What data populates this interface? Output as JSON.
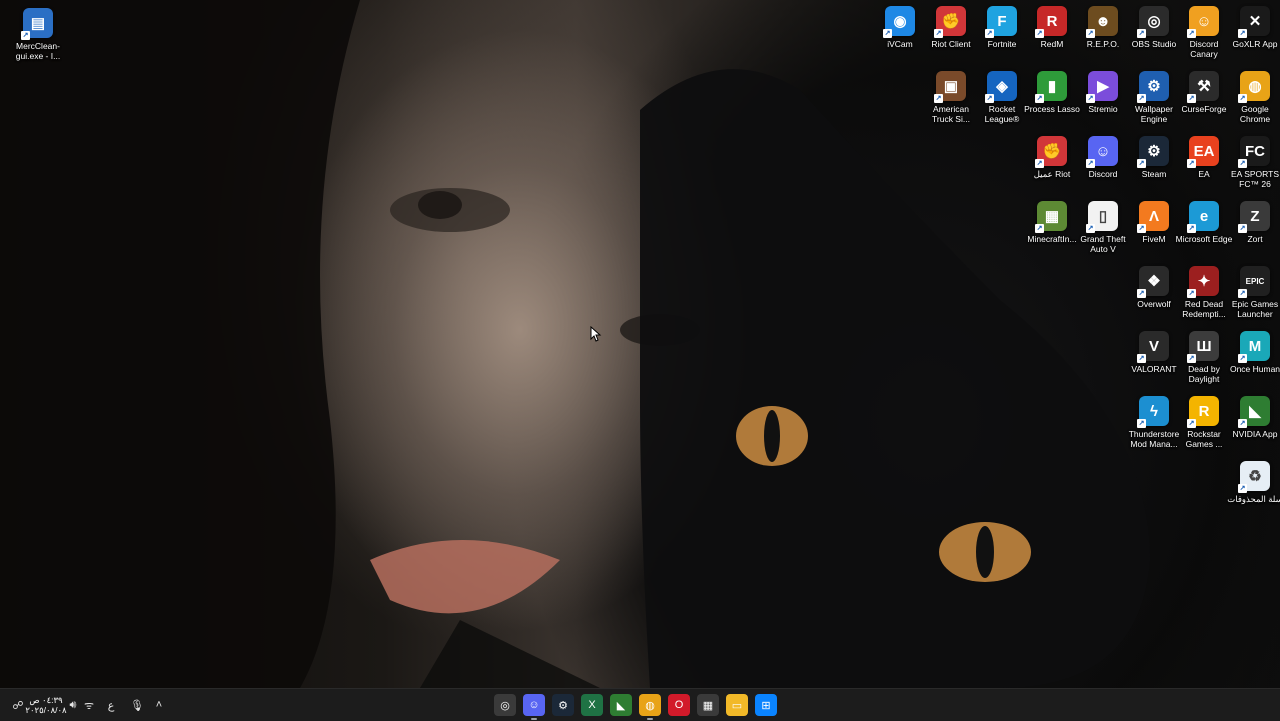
{
  "desktop": {
    "left_icons": [
      {
        "name": "merc-clean-icon",
        "label": "MercClean-gui.exe - I...",
        "color": "#2b6fc4",
        "glyph": "▤"
      }
    ],
    "grid": [
      {
        "name": "ivcam-icon",
        "label": "iVCam",
        "color": "#1e88e5",
        "glyph": "◉"
      },
      {
        "name": "riot-client-icon",
        "label": "Riot Client",
        "color": "#d13639",
        "glyph": "✊"
      },
      {
        "name": "fortnite-icon",
        "label": "Fortnite",
        "color": "#1fa3e0",
        "glyph": "F"
      },
      {
        "name": "redm-icon",
        "label": "RedM",
        "color": "#c62828",
        "glyph": "R"
      },
      {
        "name": "repo-icon",
        "label": "R.E.P.O.",
        "color": "#6d4c1f",
        "glyph": "☻"
      },
      {
        "name": "obs-studio-icon",
        "label": "OBS Studio",
        "color": "#2b2b2b",
        "glyph": "◎"
      },
      {
        "name": "discord-canary-icon",
        "label": "Discord Canary",
        "color": "#f0a020",
        "glyph": "☺"
      },
      {
        "name": "goxlr-app-icon",
        "label": "GoXLR App",
        "color": "#1a1a1a",
        "glyph": "✕"
      },
      {
        "name": "american-truck-icon",
        "label": "American Truck Si...",
        "color": "#7a4a2a",
        "glyph": "▣"
      },
      {
        "name": "rocket-league-icon",
        "label": "Rocket League®",
        "color": "#1565c0",
        "glyph": "◈"
      },
      {
        "name": "process-lasso-icon",
        "label": "Process Lasso",
        "color": "#2e9b3a",
        "glyph": "▮"
      },
      {
        "name": "stremio-icon",
        "label": "Stremio",
        "color": "#7b4ddb",
        "glyph": "▶"
      },
      {
        "name": "wallpaper-engine-icon",
        "label": "Wallpaper Engine",
        "color": "#1f5fb0",
        "glyph": "⚙"
      },
      {
        "name": "curseforge-icon",
        "label": "CurseForge",
        "color": "#2b2b2b",
        "glyph": "⚒"
      },
      {
        "name": "google-chrome-icon",
        "label": "Google Chrome",
        "color": "#e8a317",
        "glyph": "◍"
      },
      {
        "name": "riot-arabic-icon",
        "label": "عميل Riot",
        "color": "#d13639",
        "glyph": "✊"
      },
      {
        "name": "discord-icon",
        "label": "Discord",
        "color": "#5865f2",
        "glyph": "☺"
      },
      {
        "name": "steam-icon",
        "label": "Steam",
        "color": "#1b2838",
        "glyph": "⚙"
      },
      {
        "name": "ea-icon",
        "label": "EA",
        "color": "#e8411e",
        "glyph": "EA"
      },
      {
        "name": "ea-sports-fc-icon",
        "label": "EA SPORTS FC™ 26",
        "color": "#1a1a1a",
        "glyph": "FC"
      },
      {
        "name": "minecraft-icon",
        "label": "MinecraftIn...",
        "color": "#5d8a34",
        "glyph": "▦"
      },
      {
        "name": "gta-v-icon",
        "label": "Grand Theft Auto V",
        "color": "#f2f2f2",
        "glyph": "▯"
      },
      {
        "name": "fivem-icon",
        "label": "FiveM",
        "color": "#f37a1f",
        "glyph": "Λ"
      },
      {
        "name": "microsoft-edge-icon",
        "label": "Microsoft Edge",
        "color": "#1c9ad6",
        "glyph": "e"
      },
      {
        "name": "zort-icon",
        "label": "Zort",
        "color": "#3a3a3a",
        "glyph": "Z"
      },
      {
        "name": "overwolf-icon",
        "label": "Overwolf",
        "color": "#2a2a2a",
        "glyph": "❖"
      },
      {
        "name": "red-dead-icon",
        "label": "Red Dead Redempti...",
        "color": "#9c1f1f",
        "glyph": "✦"
      },
      {
        "name": "epic-games-icon",
        "label": "Epic Games Launcher",
        "color": "#202020",
        "glyph": "EPIC"
      },
      {
        "name": "valorant-icon",
        "label": "VALORANT",
        "color": "#2a2a2a",
        "glyph": "V"
      },
      {
        "name": "dead-by-daylight-icon",
        "label": "Dead by Daylight",
        "color": "#3c3c3c",
        "glyph": "Ш"
      },
      {
        "name": "once-human-icon",
        "label": "Once Human",
        "color": "#1aa8b8",
        "glyph": "M"
      },
      {
        "name": "thunderstore-icon",
        "label": "Thunderstore Mod Mana...",
        "color": "#1c8fd1",
        "glyph": "ϟ"
      },
      {
        "name": "rockstar-games-icon",
        "label": "Rockstar Games ...",
        "color": "#f4b400",
        "glyph": "R"
      },
      {
        "name": "nvidia-app-icon",
        "label": "NVIDIA App",
        "color": "#2e7d32",
        "glyph": "◣"
      },
      {
        "name": "recycle-bin-icon",
        "label": "سلة المحذوفات",
        "color": "#e6eef5",
        "glyph": "♻"
      }
    ]
  },
  "taskbar": {
    "clock_time": "٠٤:٣٩ ص",
    "clock_date": "٢٠٢٥/٠٨/٠٨",
    "language": "ع",
    "tray_icons": [
      "notification-icon",
      "volume-icon",
      "wifi-icon",
      "language-indicator",
      "microphone-icon",
      "chevron-up-icon"
    ],
    "apps": [
      {
        "name": "taskbar-app-1",
        "color": "#3a3a3a",
        "glyph": "◎",
        "active": false
      },
      {
        "name": "taskbar-discord",
        "color": "#5865f2",
        "glyph": "☺",
        "active": true
      },
      {
        "name": "taskbar-steam",
        "color": "#1b2838",
        "glyph": "⚙",
        "active": false
      },
      {
        "name": "taskbar-excel",
        "color": "#1f7244",
        "glyph": "X",
        "active": false
      },
      {
        "name": "taskbar-nvidia",
        "color": "#2e7d32",
        "glyph": "◣",
        "active": false
      },
      {
        "name": "taskbar-chrome",
        "color": "#e8a317",
        "glyph": "◍",
        "active": true
      },
      {
        "name": "taskbar-opera",
        "color": "#d21a2a",
        "glyph": "O",
        "active": false
      },
      {
        "name": "taskbar-store",
        "color": "#3a3a3a",
        "glyph": "▦",
        "active": false
      },
      {
        "name": "taskbar-explorer",
        "color": "#f2b928",
        "glyph": "▭",
        "active": false
      },
      {
        "name": "taskbar-start",
        "color": "#0a84ff",
        "glyph": "⊞",
        "active": false
      }
    ]
  }
}
